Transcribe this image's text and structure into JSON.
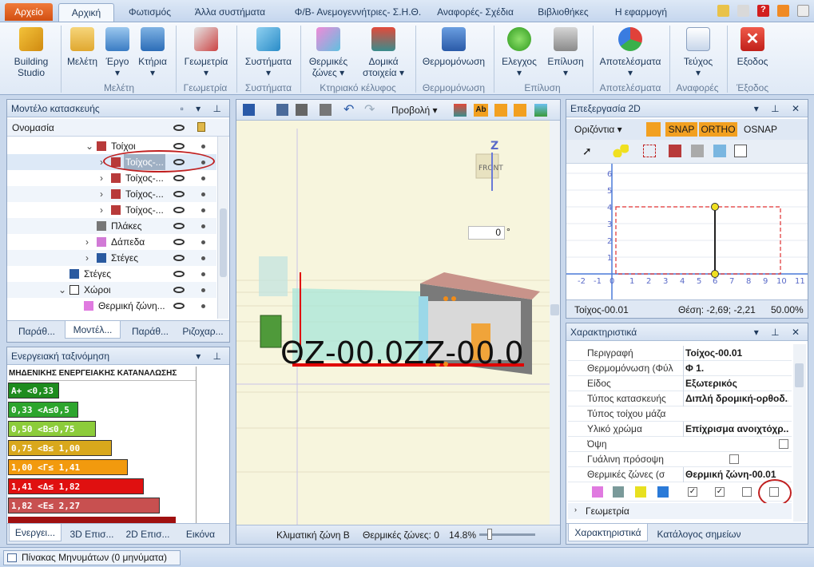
{
  "ribbon_tabs": [
    "Αρχείο",
    "Αρχική",
    "Φωτισμός",
    "Άλλα συστήματα",
    "Φ/Β- Ανεμογεννήτριες- Σ.Η.Θ.",
    "Αναφορές- Σχέδια",
    "Βιβλιοθήκες",
    "Η εφαρμογή"
  ],
  "ribbon": {
    "building_studio": "Building Studio",
    "buttons": [
      "Μελέτη",
      "Έργο",
      "Κτήρια",
      "Γεωμετρία",
      "Συστήματα",
      "Θερμικές ζώνες",
      "Δομικά στοιχεία",
      "Θερμομόνωση",
      "Ελεγχος",
      "Επίλυση",
      "Αποτελέσματα",
      "Τεύχος",
      "Εξοδος"
    ],
    "groups": [
      "Μελέτη",
      "Γεωμετρία",
      "Συστήματα",
      "Κτηριακό κέλυφος",
      "Θερμομόνωση",
      "Επίλυση",
      "Αποτελέσματα",
      "Αναφορές",
      "Έξοδος"
    ]
  },
  "model_panel": {
    "title": "Μοντέλο κατασκευής",
    "header": "Ονομασία",
    "items": [
      {
        "label": "Τοίχοι"
      },
      {
        "label": "Τοίχος-..."
      },
      {
        "label": "Τοίχος-..."
      },
      {
        "label": "Τοίχος-..."
      },
      {
        "label": "Τοίχος-..."
      },
      {
        "label": "Πλάκες"
      },
      {
        "label": "Δάπεδα"
      },
      {
        "label": "Στέγες"
      },
      {
        "label": "Στέγες"
      },
      {
        "label": "Χώροι"
      },
      {
        "label": "Θερμική ζώνη..."
      }
    ],
    "tabs": [
      "Παράθ...",
      "Μοντέλ...",
      "Παράθ...",
      "Ριζοχαρ..."
    ]
  },
  "energy_panel": {
    "title": "Ενεργειακή ταξινόμηση",
    "header": "ΜΗΔΕΝΙΚΗΣ ΕΝΕΡΓΕΙΑΚΗΣ ΚΑΤΑΝΑΛΩΣΗΣ",
    "bars": [
      {
        "label": "A+ <0,33",
        "color": "#1e8c1e"
      },
      {
        "label": "0,33 <A≤0,5",
        "color": "#2da52d"
      },
      {
        "label": "0,50 <B≤0,75",
        "color": "#8ccc3a"
      },
      {
        "label": "0,75 <B≤ 1,00",
        "color": "#d9a81c"
      },
      {
        "label": "1,00 <Γ≤ 1,41",
        "color": "#f29a0e"
      },
      {
        "label": "1,41 <Δ≤ 1,82",
        "color": "#e01010"
      },
      {
        "label": "1,82 <E≤ 2,27",
        "color": "#c85050"
      }
    ],
    "tabs": [
      "Ενεργει...",
      "3D Επισ...",
      "2D Επισ...",
      "Εικόνα"
    ]
  },
  "viewport": {
    "projection": "Προβολή",
    "angle": "0",
    "angle_unit": "°",
    "overlay_text": "ΘΖ-00.0ΖΖ-00.0",
    "front_label": "FRONT",
    "axis_label": "Z",
    "status_climate": "Κλιματική ζώνη Β",
    "status_zones": "Θερμικές ζώνες: 0",
    "zoom": "14.8%"
  },
  "edit2d": {
    "title": "Επεξεργασία 2D",
    "orientation": "Οριζόντια",
    "snap": "SNAP",
    "ortho": "ORTHO",
    "osnap": "OSNAP",
    "x_ticks": [
      "-2",
      "-1",
      "0",
      "1",
      "2",
      "3",
      "4",
      "5",
      "6",
      "7",
      "8",
      "9",
      "10",
      "11"
    ],
    "y_ticks": [
      "6",
      "5",
      "4",
      "3",
      "2",
      "1",
      "0"
    ],
    "status_name": "Τοίχος-00.01",
    "status_pos": "Θέση: -2,69; -2,21",
    "status_zoom": "50.00%"
  },
  "props": {
    "title": "Χαρακτηριστικά",
    "rows": [
      {
        "k": "Περιγραφή",
        "v": "Τοίχος-00.01"
      },
      {
        "k": "Θερμομόνωση (Φύλ",
        "v": "Φ 1."
      },
      {
        "k": "Είδος",
        "v": "Εξωτερικός"
      },
      {
        "k": "Τύπος κατασκευής",
        "v": "Διπλή δρομική-ορθοδ..."
      },
      {
        "k": "Τύπος τοίχου μάζα",
        "v": ""
      },
      {
        "k": "Υλικό χρώμα",
        "v": "Επίχρισμα ανοιχτόχρ..."
      },
      {
        "k": "Όψη",
        "v": ""
      },
      {
        "k": "Γυάλινη πρόσοψη",
        "v": ""
      },
      {
        "k": "Θερμικές ζώνες (σ",
        "v": "Θερμική ζώνη-00.01"
      }
    ],
    "section": "Γεωμετρία",
    "tabs": [
      "Χαρακτηριστικά",
      "Κατάλογος σημείων"
    ]
  },
  "statusbar": {
    "messages": "Πίνακας Μηνυμάτων (0 μηνύματα)"
  }
}
